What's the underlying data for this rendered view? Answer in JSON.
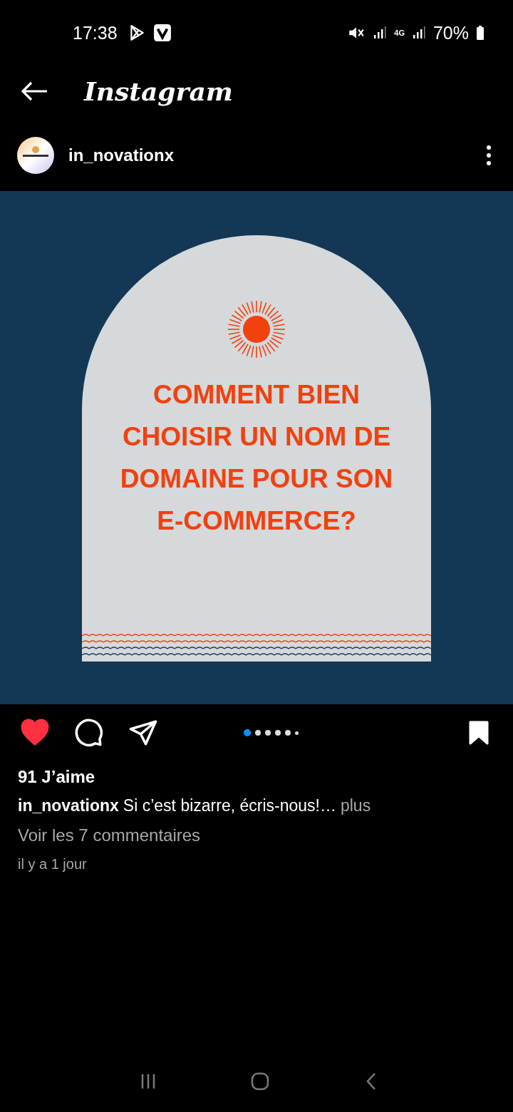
{
  "status_bar": {
    "time": "17:38",
    "network": "4G",
    "battery": "70%"
  },
  "header": {
    "title": "Instagram"
  },
  "post": {
    "username": "in_novationx",
    "title_lines": [
      "COMMENT BIEN",
      "CHOISIR UN NOM DE",
      "DOMAINE POUR SON",
      "E-COMMERCE?"
    ],
    "liked": true,
    "saved": true,
    "dots": [
      {
        "selected": true
      },
      {
        "selected": false
      },
      {
        "selected": false
      },
      {
        "selected": false
      },
      {
        "selected": false
      },
      {
        "selected": false
      }
    ],
    "likes": "91 J’aime",
    "caption_user": "in_novationx",
    "caption": "Si c’est bizarre, écris-nous!…",
    "more": "plus",
    "comments": "Voir les 7 commentaires",
    "time": "il y a 1 jour"
  }
}
